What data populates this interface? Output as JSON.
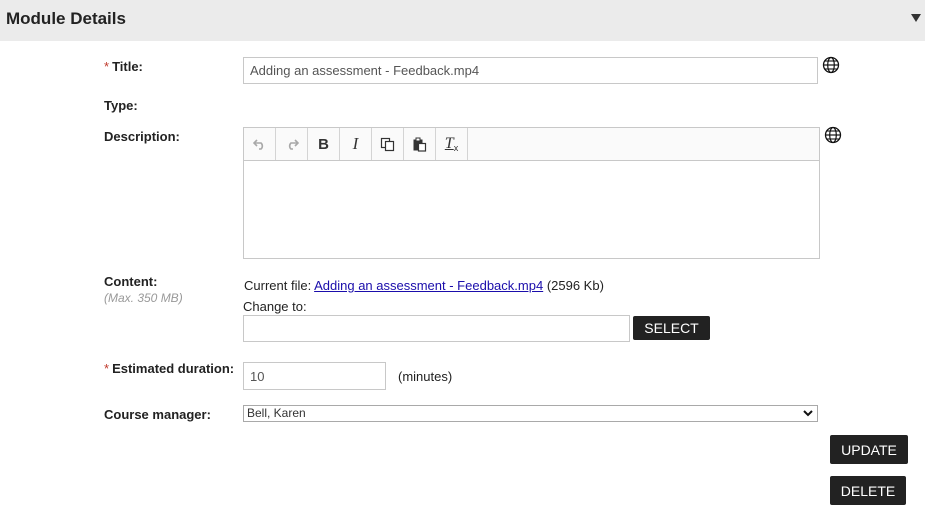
{
  "header": {
    "title": "Module Details",
    "collapse_icon": "triangle-down-icon"
  },
  "form": {
    "title": {
      "required_mark": "*",
      "label": "Title:",
      "value": "Adding an assessment - Feedback.mp4",
      "icon": "globe-icon"
    },
    "type": {
      "label": "Type:"
    },
    "description": {
      "label": "Description:",
      "icon": "globe-icon",
      "toolbar": [
        "undo-icon",
        "redo-icon",
        "bold-icon",
        "italic-icon",
        "copy-icon",
        "paste-icon",
        "clear-format-icon"
      ],
      "bold_glyph": "B",
      "italic_glyph": "I",
      "clear_glyph": "T",
      "value": ""
    },
    "content": {
      "label": "Content:",
      "hint": "(Max. 350 MB)",
      "current_file_prefix": "Current file:",
      "current_file_name": "Adding an assessment - Feedback.mp4",
      "current_file_size": "(2596 Kb)",
      "change_to_label": "Change to:",
      "change_to_value": "",
      "select_button": "SELECT"
    },
    "duration": {
      "required_mark": "*",
      "label": "Estimated duration:",
      "value": "10",
      "unit": "(minutes)"
    },
    "manager": {
      "label": "Course manager:",
      "selected": "Bell, Karen"
    }
  },
  "actions": {
    "update": "UPDATE",
    "delete": "DELETE"
  }
}
